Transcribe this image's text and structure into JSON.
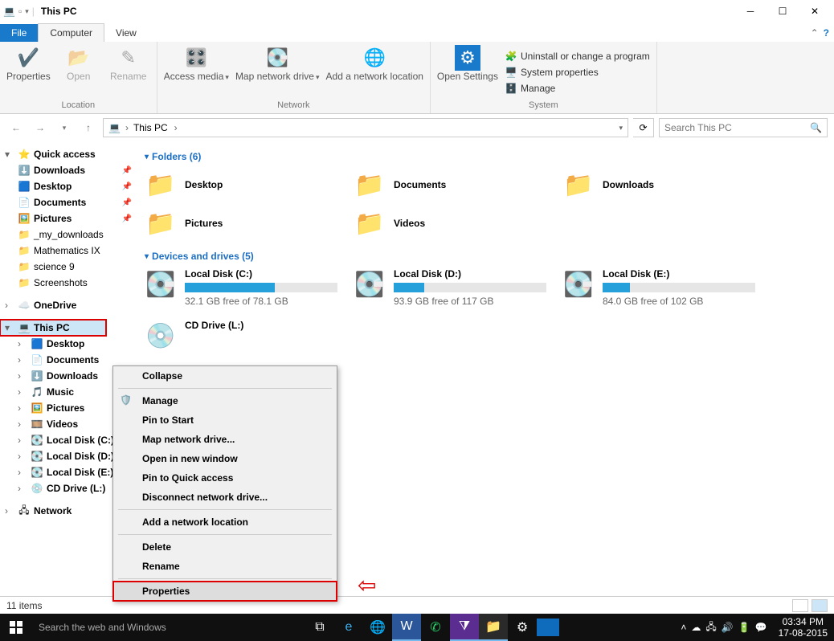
{
  "window": {
    "title": "This PC"
  },
  "tabs": {
    "file": "File",
    "computer": "Computer",
    "view": "View"
  },
  "ribbon": {
    "location": {
      "properties": "Properties",
      "open": "Open",
      "rename": "Rename",
      "label": "Location"
    },
    "network": {
      "access_media": "Access media",
      "map_drive": "Map network drive",
      "add_location": "Add a network location",
      "label": "Network"
    },
    "system": {
      "open_settings": "Open Settings",
      "uninstall": "Uninstall or change a program",
      "sys_props": "System properties",
      "manage": "Manage",
      "label": "System"
    }
  },
  "address": {
    "root": "This PC",
    "search_placeholder": "Search This PC"
  },
  "tree": {
    "quick": "Quick access",
    "quick_items": [
      "Downloads",
      "Desktop",
      "Documents",
      "Pictures",
      "_my_downloads",
      "Mathematics IX",
      "science 9",
      "Screenshots"
    ],
    "onedrive": "OneDrive",
    "this_pc": "This PC",
    "pc_items": [
      "Desktop",
      "Documents",
      "Downloads",
      "Music",
      "Pictures",
      "Videos",
      "Local Disk (C:)",
      "Local Disk (D:)",
      "Local Disk (E:)",
      "CD Drive (L:)"
    ],
    "network": "Network"
  },
  "sections": {
    "folders": "Folders (6)",
    "drives": "Devices and drives (5)"
  },
  "folders": [
    {
      "name": "Desktop",
      "icon": "🖥️"
    },
    {
      "name": "Documents",
      "icon": "📄"
    },
    {
      "name": "Downloads",
      "icon": "⬇️"
    },
    {
      "name": "Pictures",
      "icon": "🖼️"
    },
    {
      "name": "Videos",
      "icon": "🎞️"
    }
  ],
  "drives": [
    {
      "name": "Local Disk (C:)",
      "free": "32.1 GB free of 78.1 GB",
      "fill": 59,
      "icon": "💽"
    },
    {
      "name": "Local Disk (D:)",
      "free": "93.9 GB free of 117 GB",
      "fill": 20,
      "icon": "💽"
    },
    {
      "name": "Local Disk (E:)",
      "free": "84.0 GB free of 102 GB",
      "fill": 18,
      "icon": "💽"
    },
    {
      "name": "CD Drive (L:)",
      "free": "",
      "fill": 0,
      "icon": "💿"
    }
  ],
  "ctx": {
    "collapse": "Collapse",
    "manage": "Manage",
    "pin_start": "Pin to Start",
    "map": "Map network drive...",
    "open_new": "Open in new window",
    "pin_quick": "Pin to Quick access",
    "disconnect": "Disconnect network drive...",
    "add_loc": "Add a network location",
    "delete": "Delete",
    "rename": "Rename",
    "properties": "Properties"
  },
  "status": {
    "items": "11 items"
  },
  "taskbar": {
    "search": "Search the web and Windows",
    "time": "03:34 PM",
    "date": "17-08-2015"
  }
}
